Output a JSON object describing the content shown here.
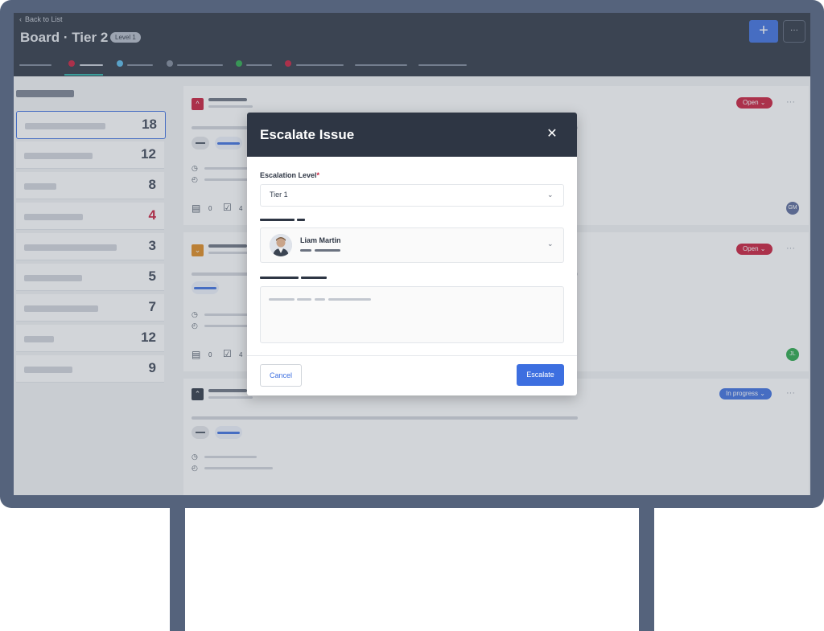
{
  "header": {
    "back_link": "Back to List",
    "title": "Board · Tier 2",
    "level_badge": "Level 1",
    "add_icon": "+",
    "more_icon": "···"
  },
  "sidebar": {
    "items": [
      {
        "count": "18",
        "selected": true
      },
      {
        "count": "12"
      },
      {
        "count": "8"
      },
      {
        "count": "4",
        "color": "#c91c3b"
      },
      {
        "count": "3"
      },
      {
        "count": "5"
      },
      {
        "count": "7"
      },
      {
        "count": "12"
      },
      {
        "count": "9"
      }
    ]
  },
  "cards": [
    {
      "status": "Open",
      "status_color": "#c91c3b",
      "priority_icon": "chevron-up-icon",
      "priority_glyph": "^",
      "priority_color": "#c91c3b",
      "comments": "0",
      "tasks": "4",
      "avatar": "GM",
      "avatar_color": "#5b6a9a"
    },
    {
      "status": "Open",
      "status_color": "#c91c3b",
      "priority_icon": "chevron-down-icon",
      "priority_glyph": "⌄",
      "priority_color": "#e08a1e",
      "comments": "0",
      "tasks": "4",
      "avatar": "JL",
      "avatar_color": "#2aa84a"
    },
    {
      "status": "In progress",
      "status_color": "#3d6fe0",
      "priority_icon": "double-chevron-up-icon",
      "priority_glyph": "⌃",
      "priority_color": "#2e3644"
    }
  ],
  "modal": {
    "title": "Escalate Issue",
    "close_icon": "✕",
    "escalation_label": "Escalation Level",
    "required_mark": "*",
    "escalation_value": "Tier 1",
    "assignee_name": "Liam Martin",
    "cancel_label": "Cancel",
    "escalate_label": "Escalate"
  },
  "colors": {
    "accent": "#3d6fe0",
    "dark": "#2e3644",
    "danger": "#c91c3b",
    "frame": "#55637c"
  }
}
